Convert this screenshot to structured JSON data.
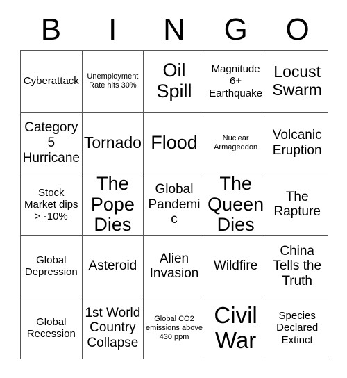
{
  "card": {
    "title": "BINGO",
    "header_letters": [
      "B",
      "I",
      "N",
      "G",
      "O"
    ],
    "grid_size": "5x5",
    "colors": {
      "background": "#ffffff",
      "text": "#000000",
      "grid_line": "#555555"
    },
    "rows": [
      [
        {
          "text": "Cyberattack",
          "size": "sm"
        },
        {
          "text": "Unemployment Rate hits 30%",
          "size": "xs"
        },
        {
          "text": "Oil Spill",
          "size": "xl"
        },
        {
          "text": "Magnitude 6+ Earthquake",
          "size": "sm"
        },
        {
          "text": "Locust Swarm",
          "size": "lg"
        }
      ],
      [
        {
          "text": "Category 5 Hurricane",
          "size": "md"
        },
        {
          "text": "Tornado",
          "size": "lg"
        },
        {
          "text": "Flood",
          "size": "xl"
        },
        {
          "text": "Nuclear Armageddon",
          "size": "xs"
        },
        {
          "text": "Volcanic Eruption",
          "size": "md"
        }
      ],
      [
        {
          "text": "Stock Market dips > -10%",
          "size": "sm"
        },
        {
          "text": "The Pope Dies",
          "size": "xl"
        },
        {
          "text": "Global Pandemic",
          "size": "md"
        },
        {
          "text": "The Queen Dies",
          "size": "xl"
        },
        {
          "text": "The Rapture",
          "size": "md"
        }
      ],
      [
        {
          "text": "Global Depression",
          "size": "sm"
        },
        {
          "text": "Asteroid",
          "size": "md"
        },
        {
          "text": "Alien Invasion",
          "size": "md"
        },
        {
          "text": "Wildfire",
          "size": "md"
        },
        {
          "text": "China Tells the Truth",
          "size": "md"
        }
      ],
      [
        {
          "text": "Global Recession",
          "size": "sm"
        },
        {
          "text": "1st World Country Collapse",
          "size": "md"
        },
        {
          "text": "Global CO2 emissions above 430 ppm",
          "size": "xs"
        },
        {
          "text": "Civil War",
          "size": "xxl"
        },
        {
          "text": "Species Declared Extinct",
          "size": "sm"
        }
      ]
    ]
  }
}
